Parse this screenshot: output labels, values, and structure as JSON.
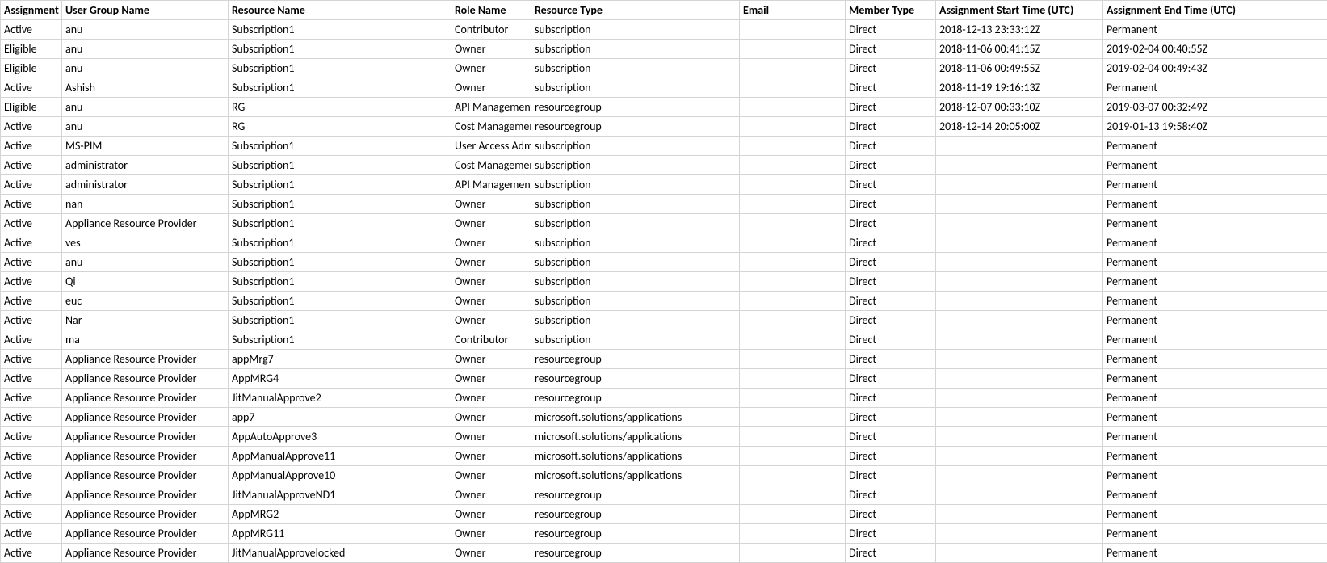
{
  "table": {
    "headers": [
      "Assignment",
      "User Group Name",
      "Resource Name",
      "Role Name",
      "Resource Type",
      "Email",
      "Member Type",
      "Assignment Start Time (UTC)",
      "Assignment End Time (UTC)"
    ],
    "rows": [
      [
        "Active",
        "anu",
        "Subscription1",
        "Contributor",
        "subscription",
        "",
        "Direct",
        "2018-12-13 23:33:12Z",
        "Permanent"
      ],
      [
        "Eligible",
        "anu",
        "Subscription1",
        "Owner",
        "subscription",
        "",
        "Direct",
        "2018-11-06 00:41:15Z",
        "2019-02-04 00:40:55Z"
      ],
      [
        "Eligible",
        "anu",
        "Subscription1",
        "Owner",
        "subscription",
        "",
        "Direct",
        "2018-11-06 00:49:55Z",
        "2019-02-04 00:49:43Z"
      ],
      [
        "Active",
        "Ashish",
        "Subscription1",
        "Owner",
        "subscription",
        "",
        "Direct",
        "2018-11-19 19:16:13Z",
        "Permanent"
      ],
      [
        "Eligible",
        "anu",
        "RG",
        "API Management Service Contributor",
        "resourcegroup",
        "",
        "Direct",
        "2018-12-07 00:33:10Z",
        "2019-03-07 00:32:49Z"
      ],
      [
        "Active",
        "anu",
        "RG",
        "Cost Management Contributor",
        "resourcegroup",
        "",
        "Direct",
        "2018-12-14 20:05:00Z",
        "2019-01-13 19:58:40Z"
      ],
      [
        "Active",
        "MS-PIM",
        "Subscription1",
        "User Access Administrator",
        "subscription",
        "",
        "Direct",
        "",
        "Permanent"
      ],
      [
        "Active",
        "administrator",
        "Subscription1",
        "Cost Management Contributor",
        "subscription",
        "",
        "Direct",
        "",
        "Permanent"
      ],
      [
        "Active",
        "administrator",
        "Subscription1",
        "API Management Service Contributor",
        "subscription",
        "",
        "Direct",
        "",
        "Permanent"
      ],
      [
        "Active",
        "nan",
        "Subscription1",
        "Owner",
        "subscription",
        "",
        "Direct",
        "",
        "Permanent"
      ],
      [
        "Active",
        "Appliance Resource Provider",
        "Subscription1",
        "Owner",
        "subscription",
        "",
        "Direct",
        "",
        "Permanent"
      ],
      [
        "Active",
        "ves",
        "Subscription1",
        "Owner",
        "subscription",
        "",
        "Direct",
        "",
        "Permanent"
      ],
      [
        "Active",
        "anu",
        "Subscription1",
        "Owner",
        "subscription",
        "",
        "Direct",
        "",
        "Permanent"
      ],
      [
        "Active",
        "Qi",
        "Subscription1",
        "Owner",
        "subscription",
        "",
        "Direct",
        "",
        "Permanent"
      ],
      [
        "Active",
        "euc",
        "Subscription1",
        "Owner",
        "subscription",
        "",
        "Direct",
        "",
        "Permanent"
      ],
      [
        "Active",
        "Nar",
        "Subscription1",
        "Owner",
        "subscription",
        "",
        "Direct",
        "",
        "Permanent"
      ],
      [
        "Active",
        "ma",
        "Subscription1",
        "Contributor",
        "subscription",
        "",
        "Direct",
        "",
        "Permanent"
      ],
      [
        "Active",
        "Appliance Resource Provider",
        "appMrg7",
        "Owner",
        "resourcegroup",
        "",
        "Direct",
        "",
        "Permanent"
      ],
      [
        "Active",
        "Appliance Resource Provider",
        "AppMRG4",
        "Owner",
        "resourcegroup",
        "",
        "Direct",
        "",
        "Permanent"
      ],
      [
        "Active",
        "Appliance Resource Provider",
        "JitManualApprove2",
        "Owner",
        "resourcegroup",
        "",
        "Direct",
        "",
        "Permanent"
      ],
      [
        "Active",
        "Appliance Resource Provider",
        "app7",
        "Owner",
        "microsoft.solutions/applications",
        "",
        "Direct",
        "",
        "Permanent"
      ],
      [
        "Active",
        "Appliance Resource Provider",
        "AppAutoApprove3",
        "Owner",
        "microsoft.solutions/applications",
        "",
        "Direct",
        "",
        "Permanent"
      ],
      [
        "Active",
        "Appliance Resource Provider",
        "AppManualApprove11",
        "Owner",
        "microsoft.solutions/applications",
        "",
        "Direct",
        "",
        "Permanent"
      ],
      [
        "Active",
        "Appliance Resource Provider",
        "AppManualApprove10",
        "Owner",
        "microsoft.solutions/applications",
        "",
        "Direct",
        "",
        "Permanent"
      ],
      [
        "Active",
        "Appliance Resource Provider",
        "JitManualApproveND1",
        "Owner",
        "resourcegroup",
        "",
        "Direct",
        "",
        "Permanent"
      ],
      [
        "Active",
        "Appliance Resource Provider",
        "AppMRG2",
        "Owner",
        "resourcegroup",
        "",
        "Direct",
        "",
        "Permanent"
      ],
      [
        "Active",
        "Appliance Resource Provider",
        "AppMRG11",
        "Owner",
        "resourcegroup",
        "",
        "Direct",
        "",
        "Permanent"
      ],
      [
        "Active",
        "Appliance Resource Provider",
        "JitManualApprovelocked",
        "Owner",
        "resourcegroup",
        "",
        "Direct",
        "",
        "Permanent"
      ]
    ]
  }
}
